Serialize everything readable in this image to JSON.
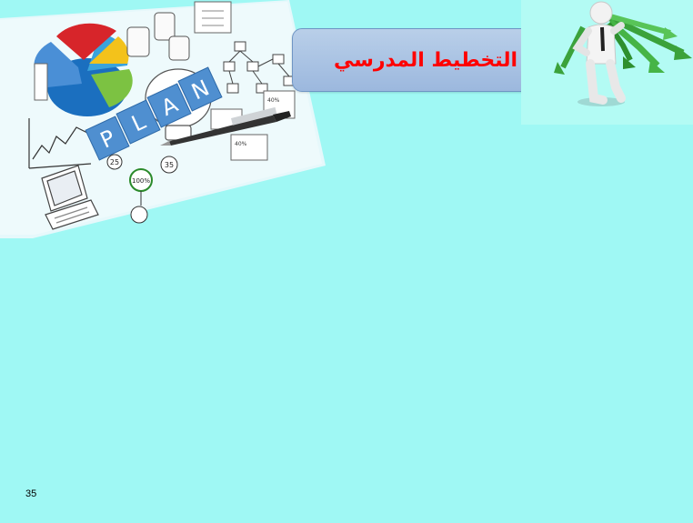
{
  "slide": {
    "title": "التخطيط المدرسي",
    "page_number": "35"
  },
  "plan_image": {
    "tiles": [
      "P",
      "L",
      "A",
      "N"
    ],
    "badges": [
      "25",
      "35",
      "100%"
    ],
    "small_labels": [
      "40%",
      "40%"
    ]
  },
  "colors": {
    "background": "#9ff8f4",
    "title_text": "#ff0000",
    "title_box": "#a9c4e6"
  },
  "icons": [
    "pie-chart-icon",
    "pen-icon",
    "laptop-icon",
    "lightbulb-icon",
    "flowchart-icon",
    "person-figure-icon",
    "green-arrows-icon"
  ]
}
